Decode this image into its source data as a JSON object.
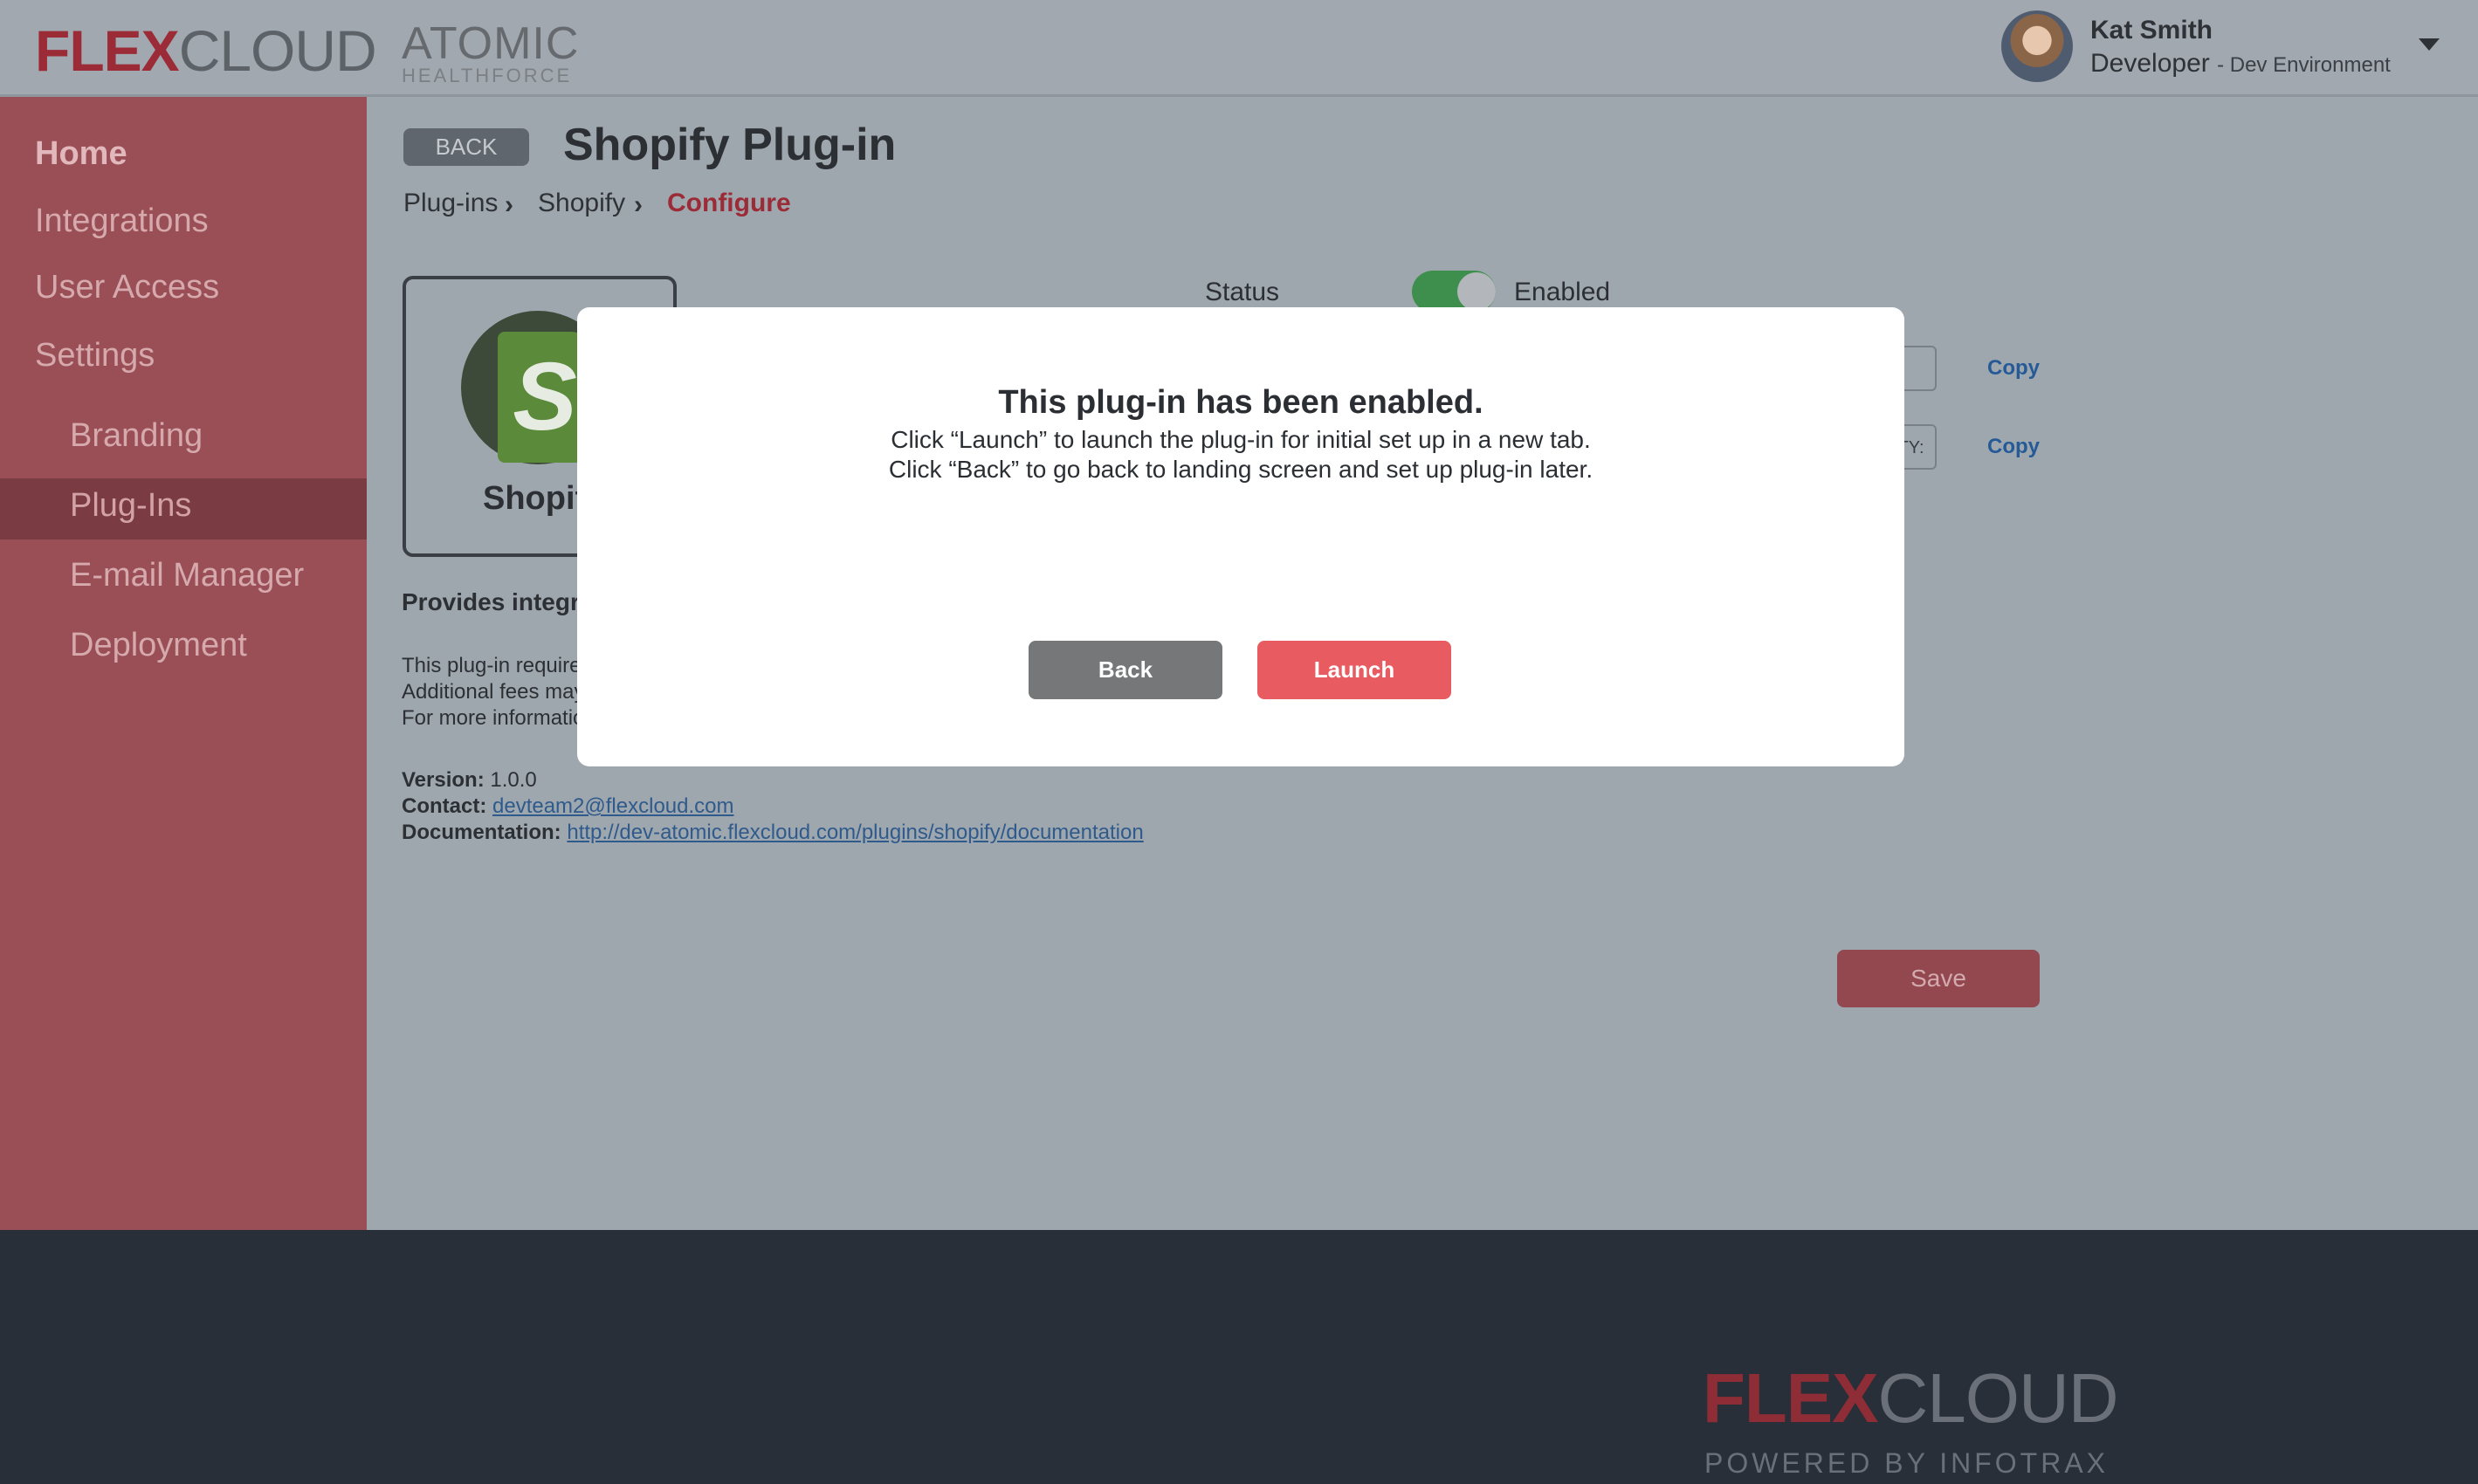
{
  "header": {
    "logo": {
      "flex": "FLEX",
      "cloud": "CLOUD"
    },
    "client_logo": {
      "line1": "ATOMIC",
      "line2": "HEALTHFORCE"
    },
    "user": {
      "name": "Kat Smith",
      "role": "Developer",
      "environment": "- Dev Environment"
    }
  },
  "sidebar": {
    "items": [
      {
        "label": "Home"
      },
      {
        "label": "Integrations"
      },
      {
        "label": "User Access"
      },
      {
        "label": "Settings"
      },
      {
        "label": "Branding"
      },
      {
        "label": "Plug-Ins"
      },
      {
        "label": "E-mail Manager"
      },
      {
        "label": "Deployment"
      }
    ],
    "active_item": "Plug-Ins"
  },
  "main": {
    "back_label": "BACK",
    "title": "Shopify Plug-in",
    "breadcrumb": [
      "Plug-ins",
      "Shopify",
      "Configure"
    ],
    "plugin_card_name": "Shopify",
    "description_heading": "Provides integra",
    "description_lines": [
      "This plug-in require",
      "Additional fees may",
      "For more informatio"
    ],
    "version_label": "Version:",
    "version": "1.0.0",
    "contact_label": "Contact:",
    "contact": "devteam2@flexcloud.com",
    "documentation_label": "Documentation:",
    "documentation": "http://dev-atomic.flexcloud.com/plugins/shopify/documentation",
    "status_label": "Status",
    "status_value": "Enabled",
    "field2_partial": "ITY:",
    "copy_label": "Copy",
    "save_label": "Save"
  },
  "modal": {
    "title": "This plug-in has been enabled.",
    "line1": "Click “Launch” to launch the plug-in for initial set up in a new tab.",
    "line2": "Click “Back” to go back to landing screen and set up plug-in later.",
    "back_label": "Back",
    "launch_label": "Launch"
  },
  "footer": {
    "logo": {
      "flex": "FLEX",
      "cloud": "CLOUD"
    },
    "powered_by": "POWERED BY INFOTRAX"
  },
  "colors": {
    "brand_red": "#9b2b37",
    "launch_button": "#e85b60",
    "back_button": "#767778",
    "toggle_on": "#3e8f4e",
    "link": "#255a97"
  }
}
